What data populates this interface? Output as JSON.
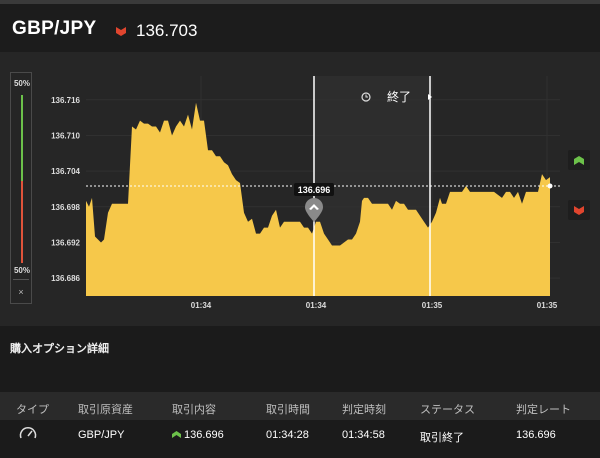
{
  "header": {
    "pair": "GBP/JPY",
    "rate": "136.703",
    "direction": "down",
    "down_color": "#e0452e"
  },
  "gauge": {
    "top_label": "50%",
    "bottom_label": "50%",
    "close_label": "×"
  },
  "chart_data": {
    "type": "area",
    "color": "#f6c84a",
    "y_ticks": [
      "136.716",
      "136.710",
      "136.704",
      "136.698",
      "136.692",
      "136.686"
    ],
    "x_ticks": [
      "01:34",
      "01:34",
      "01:35",
      "01:35"
    ],
    "current_rate": "136.696",
    "end_label": "終了",
    "points": [
      [
        0,
        136.699
      ],
      [
        3,
        136.698
      ],
      [
        6,
        136.6995
      ],
      [
        9,
        136.693
      ],
      [
        12,
        136.6925
      ],
      [
        15,
        136.692
      ],
      [
        18,
        136.6925
      ],
      [
        22,
        136.697
      ],
      [
        26,
        136.6985
      ],
      [
        30,
        136.6985
      ],
      [
        34,
        136.6985
      ],
      [
        38,
        136.6985
      ],
      [
        42,
        136.6985
      ],
      [
        46,
        136.7115
      ],
      [
        50,
        136.711
      ],
      [
        54,
        136.7125
      ],
      [
        58,
        136.712
      ],
      [
        62,
        136.712
      ],
      [
        66,
        136.7115
      ],
      [
        70,
        136.7115
      ],
      [
        74,
        136.7105
      ],
      [
        78,
        136.7125
      ],
      [
        82,
        136.7125
      ],
      [
        86,
        136.71
      ],
      [
        90,
        136.7115
      ],
      [
        94,
        136.7125
      ],
      [
        98,
        136.7115
      ],
      [
        102,
        136.7135
      ],
      [
        106,
        136.711
      ],
      [
        110,
        136.7155
      ],
      [
        114,
        136.7125
      ],
      [
        118,
        136.7125
      ],
      [
        122,
        136.7075
      ],
      [
        126,
        136.7075
      ],
      [
        130,
        136.7065
      ],
      [
        134,
        136.7065
      ],
      [
        138,
        136.7055
      ],
      [
        142,
        136.705
      ],
      [
        146,
        136.7035
      ],
      [
        150,
        136.7025
      ],
      [
        154,
        136.702
      ],
      [
        158,
        136.697
      ],
      [
        162,
        136.6955
      ],
      [
        166,
        136.696
      ],
      [
        170,
        136.6935
      ],
      [
        174,
        136.6935
      ],
      [
        178,
        136.6945
      ],
      [
        182,
        136.6945
      ],
      [
        186,
        136.6965
      ],
      [
        190,
        136.6975
      ],
      [
        194,
        136.6945
      ],
      [
        198,
        136.6955
      ],
      [
        202,
        136.6955
      ],
      [
        206,
        136.6955
      ],
      [
        210,
        136.6955
      ],
      [
        214,
        136.6955
      ],
      [
        218,
        136.6945
      ],
      [
        222,
        136.6945
      ],
      [
        226,
        136.6935
      ],
      [
        230,
        136.6955
      ],
      [
        234,
        136.6955
      ],
      [
        238,
        136.6935
      ],
      [
        242,
        136.6925
      ],
      [
        246,
        136.6915
      ],
      [
        250,
        136.6915
      ],
      [
        254,
        136.6915
      ],
      [
        258,
        136.692
      ],
      [
        262,
        136.6925
      ],
      [
        266,
        136.6925
      ],
      [
        270,
        136.6935
      ],
      [
        274,
        136.6955
      ],
      [
        276,
        136.699
      ],
      [
        278,
        136.6995
      ],
      [
        282,
        136.6995
      ],
      [
        286,
        136.6985
      ],
      [
        290,
        136.6985
      ],
      [
        294,
        136.6985
      ],
      [
        298,
        136.6985
      ],
      [
        302,
        136.6985
      ],
      [
        306,
        136.6975
      ],
      [
        310,
        136.699
      ],
      [
        314,
        136.6985
      ],
      [
        318,
        136.6985
      ],
      [
        322,
        136.6975
      ],
      [
        326,
        136.6975
      ],
      [
        330,
        136.6975
      ],
      [
        334,
        136.6965
      ],
      [
        338,
        136.6955
      ],
      [
        342,
        136.6945
      ],
      [
        346,
        136.6955
      ],
      [
        350,
        136.697
      ],
      [
        354,
        136.6995
      ],
      [
        356,
        136.6985
      ],
      [
        360,
        136.6985
      ],
      [
        364,
        136.7005
      ],
      [
        368,
        136.7005
      ],
      [
        372,
        136.7005
      ],
      [
        376,
        136.7005
      ],
      [
        380,
        136.7015
      ],
      [
        384,
        136.7005
      ],
      [
        388,
        136.7005
      ],
      [
        392,
        136.7005
      ],
      [
        396,
        136.7005
      ],
      [
        400,
        136.7005
      ],
      [
        404,
        136.7005
      ],
      [
        408,
        136.7005
      ],
      [
        412,
        136.7
      ],
      [
        416,
        136.6995
      ],
      [
        420,
        136.7005
      ],
      [
        424,
        136.7005
      ],
      [
        428,
        136.6995
      ],
      [
        432,
        136.7005
      ],
      [
        436,
        136.6985
      ],
      [
        440,
        136.7005
      ],
      [
        444,
        136.7005
      ],
      [
        448,
        136.7005
      ],
      [
        452,
        136.7005
      ],
      [
        456,
        136.7035
      ],
      [
        460,
        136.7025
      ],
      [
        464,
        136.703
      ]
    ],
    "y_min": 136.683,
    "y_max": 136.72,
    "x_max": 464,
    "entry_index": 180,
    "expiry_index": 344
  },
  "section": {
    "title": "購入オプション詳細"
  },
  "table": {
    "headers": [
      "タイプ",
      "取引原資産",
      "取引内容",
      "取引時間",
      "判定時刻",
      "ステータス",
      "判定レート"
    ],
    "row": {
      "icon": "gauge-icon",
      "asset": "GBP/JPY",
      "trade": "136.696",
      "trade_direction": "up",
      "trade_color": "#6cc14a",
      "time": "01:34:28",
      "judge_time": "01:34:58",
      "status": "取引終了",
      "judge_rate": "136.696"
    }
  }
}
